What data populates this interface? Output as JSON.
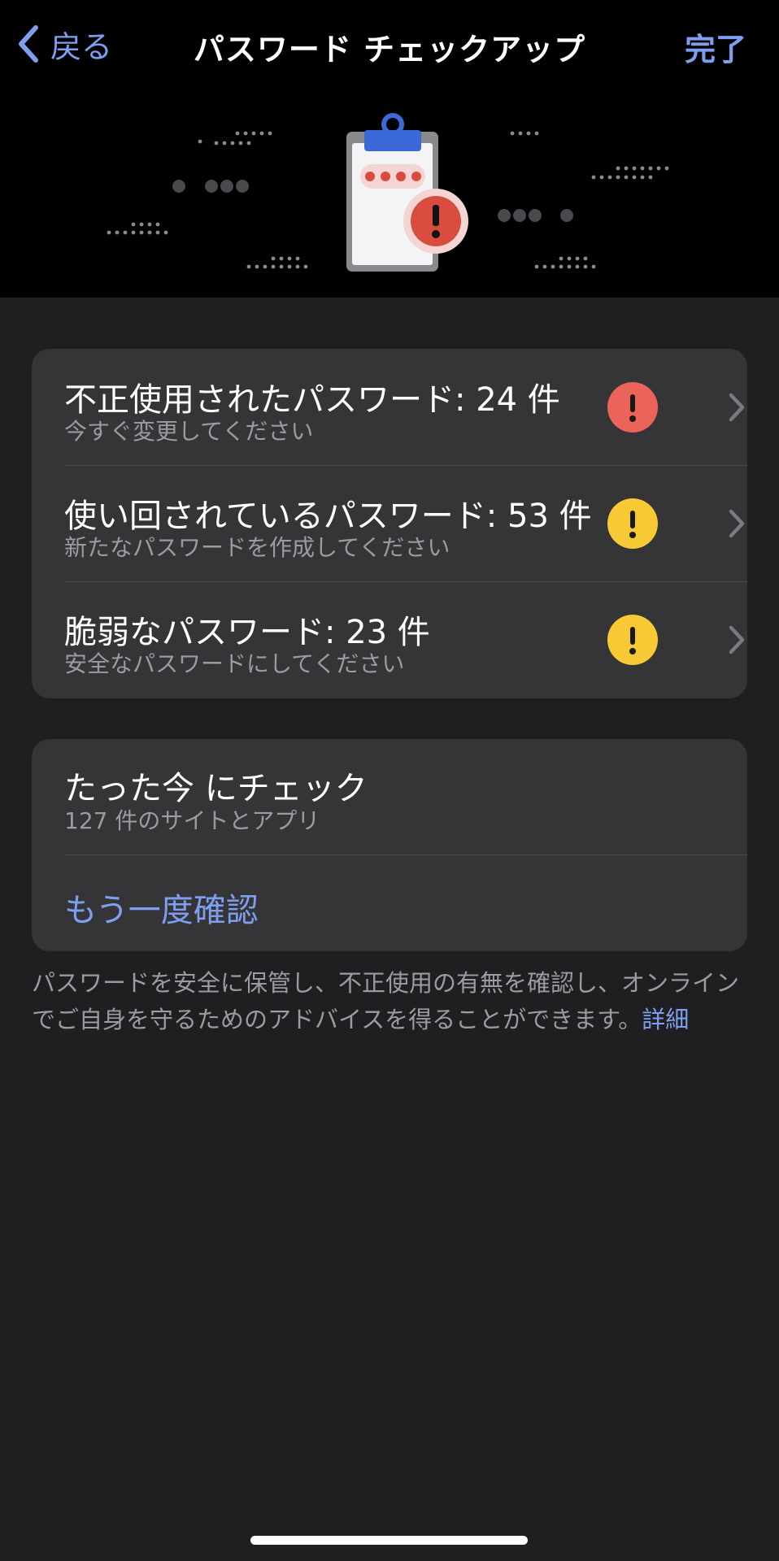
{
  "nav": {
    "back_label": "戻る",
    "title": "パスワード チェックアップ",
    "done_label": "完了"
  },
  "issues": [
    {
      "title": "不正使用されたパスワード: 24 件",
      "subtitle": "今すぐ変更してください",
      "severity": "critical",
      "badge_color": "#ec6459"
    },
    {
      "title": "使い回されているパスワード: 53 件",
      "subtitle": "新たなパスワードを作成してください",
      "severity": "warning",
      "badge_color": "#f7c934"
    },
    {
      "title": "脆弱なパスワード: 23 件",
      "subtitle": "安全なパスワードにしてください",
      "severity": "warning",
      "badge_color": "#f7c934"
    }
  ],
  "check": {
    "title": "たった今 にチェック",
    "subtitle": "127 件のサイトとアプリ",
    "recheck_label": "もう一度確認"
  },
  "footer": {
    "text": "パスワードを安全に保管し、不正使用の有無を確認し、オンラインでご自身を守るためのアドバイスを得ることができます。",
    "link_label": "詳細"
  },
  "colors": {
    "accent": "#7e9ff0",
    "background": "#1f1f22",
    "card": "#353538",
    "header": "#000000"
  },
  "icons": {
    "back": "chevron-left-icon",
    "illustration": "clipboard-password-alert-illustration",
    "alert": "exclamation-icon",
    "disclosure": "chevron-right-icon"
  }
}
